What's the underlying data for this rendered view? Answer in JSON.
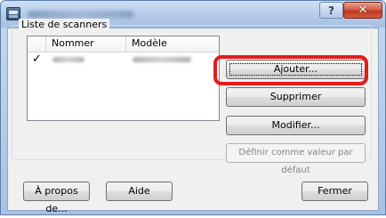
{
  "window": {
    "help_label": "?",
    "close_label": "✕"
  },
  "group": {
    "label": "Liste de scanners"
  },
  "list": {
    "columns": [
      "Nommer",
      "Modèle"
    ],
    "rows": [
      {
        "checked": true,
        "check_glyph": "✓"
      }
    ]
  },
  "buttons": {
    "add": "Ajouter...",
    "delete": "Supprimer",
    "modify": "Modifier...",
    "set_default": "Définir comme valeur par défaut",
    "about": "À propos de...",
    "help": "Aide",
    "close": "Fermer"
  },
  "colors": {
    "highlight": "#e41b1b"
  }
}
